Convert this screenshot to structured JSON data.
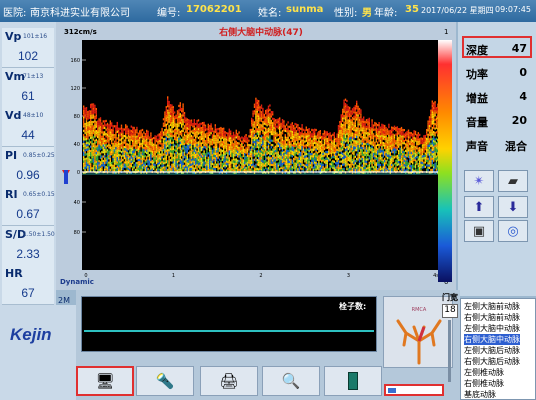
{
  "header": {
    "hospital_label": "医院:",
    "hospital_value": "南京科进实业有限公司",
    "id_label": "编号:",
    "id_value": "17062201",
    "name_label": "姓名:",
    "name_value": "sunma",
    "sex_label": "性别:",
    "sex_value": "男",
    "age_label": "年龄:",
    "age_value": "35",
    "date": "2017/06/22 星期四",
    "time": "09:07:45"
  },
  "measurements": [
    {
      "name": "Vp",
      "range": "101±16",
      "value": "102"
    },
    {
      "name": "Vm",
      "range": "71±13",
      "value": "61"
    },
    {
      "name": "Vd",
      "range": "48±10",
      "value": "44"
    },
    {
      "name": "PI",
      "range": "0.85±0.25",
      "value": "0.96"
    },
    {
      "name": "RI",
      "range": "0.65±0.15",
      "value": "0.67"
    },
    {
      "name": "S/D",
      "range": "1.50±1.50",
      "value": "2.33"
    },
    {
      "name": "HR",
      "range": "",
      "value": "67"
    }
  ],
  "logo": "Kejin",
  "spectrum": {
    "title": "右侧大脑中动脉(47)",
    "scale_label": "312cm/s",
    "y_ticks": [
      "160",
      "120",
      "80",
      "40",
      "0",
      "40",
      "80"
    ],
    "x_ticks": [
      "0",
      "1",
      "2",
      "3",
      "4"
    ],
    "x_unit": "s",
    "mode_label": "Dynamic",
    "colorbar_top": "1",
    "colorbar_bottom": "0"
  },
  "params": [
    {
      "label": "深度",
      "value": "47"
    },
    {
      "label": "功率",
      "value": "0"
    },
    {
      "label": "增益",
      "value": "4"
    },
    {
      "label": "音量",
      "value": "20"
    },
    {
      "label": "声音",
      "value": "混合"
    }
  ],
  "mmode": {
    "label_2m": "2M",
    "emboli_label": "栓子数:"
  },
  "gate": {
    "label": "门宽",
    "value": "18"
  },
  "progress": 0.15,
  "vessels": [
    {
      "label": "左侧大脑前动脉",
      "selected": false
    },
    {
      "label": "右侧大脑前动脉",
      "selected": false
    },
    {
      "label": "左侧大脑中动脉",
      "selected": false
    },
    {
      "label": "右侧大脑中动脉",
      "selected": true
    },
    {
      "label": "左侧大脑后动脉",
      "selected": false
    },
    {
      "label": "右侧大脑后动脉",
      "selected": false
    },
    {
      "label": "左侧椎动脉",
      "selected": false
    },
    {
      "label": "右侧椎动脉",
      "selected": false
    },
    {
      "label": "基底动脉",
      "selected": false
    }
  ],
  "icons": {
    "right_buttons": [
      "star-icon",
      "eraser-icon",
      "up-arrow-icon",
      "down-arrow-icon",
      "probe-icon",
      "disc-icon"
    ],
    "bottom_buttons": [
      "patient-icon",
      "probe-wand-icon",
      "printer-icon",
      "search-report-icon",
      "exit-icon"
    ]
  },
  "colors": {
    "header": "#2e6aa0",
    "highlight_border": "#e03030",
    "selection": "#2d5fd0"
  }
}
